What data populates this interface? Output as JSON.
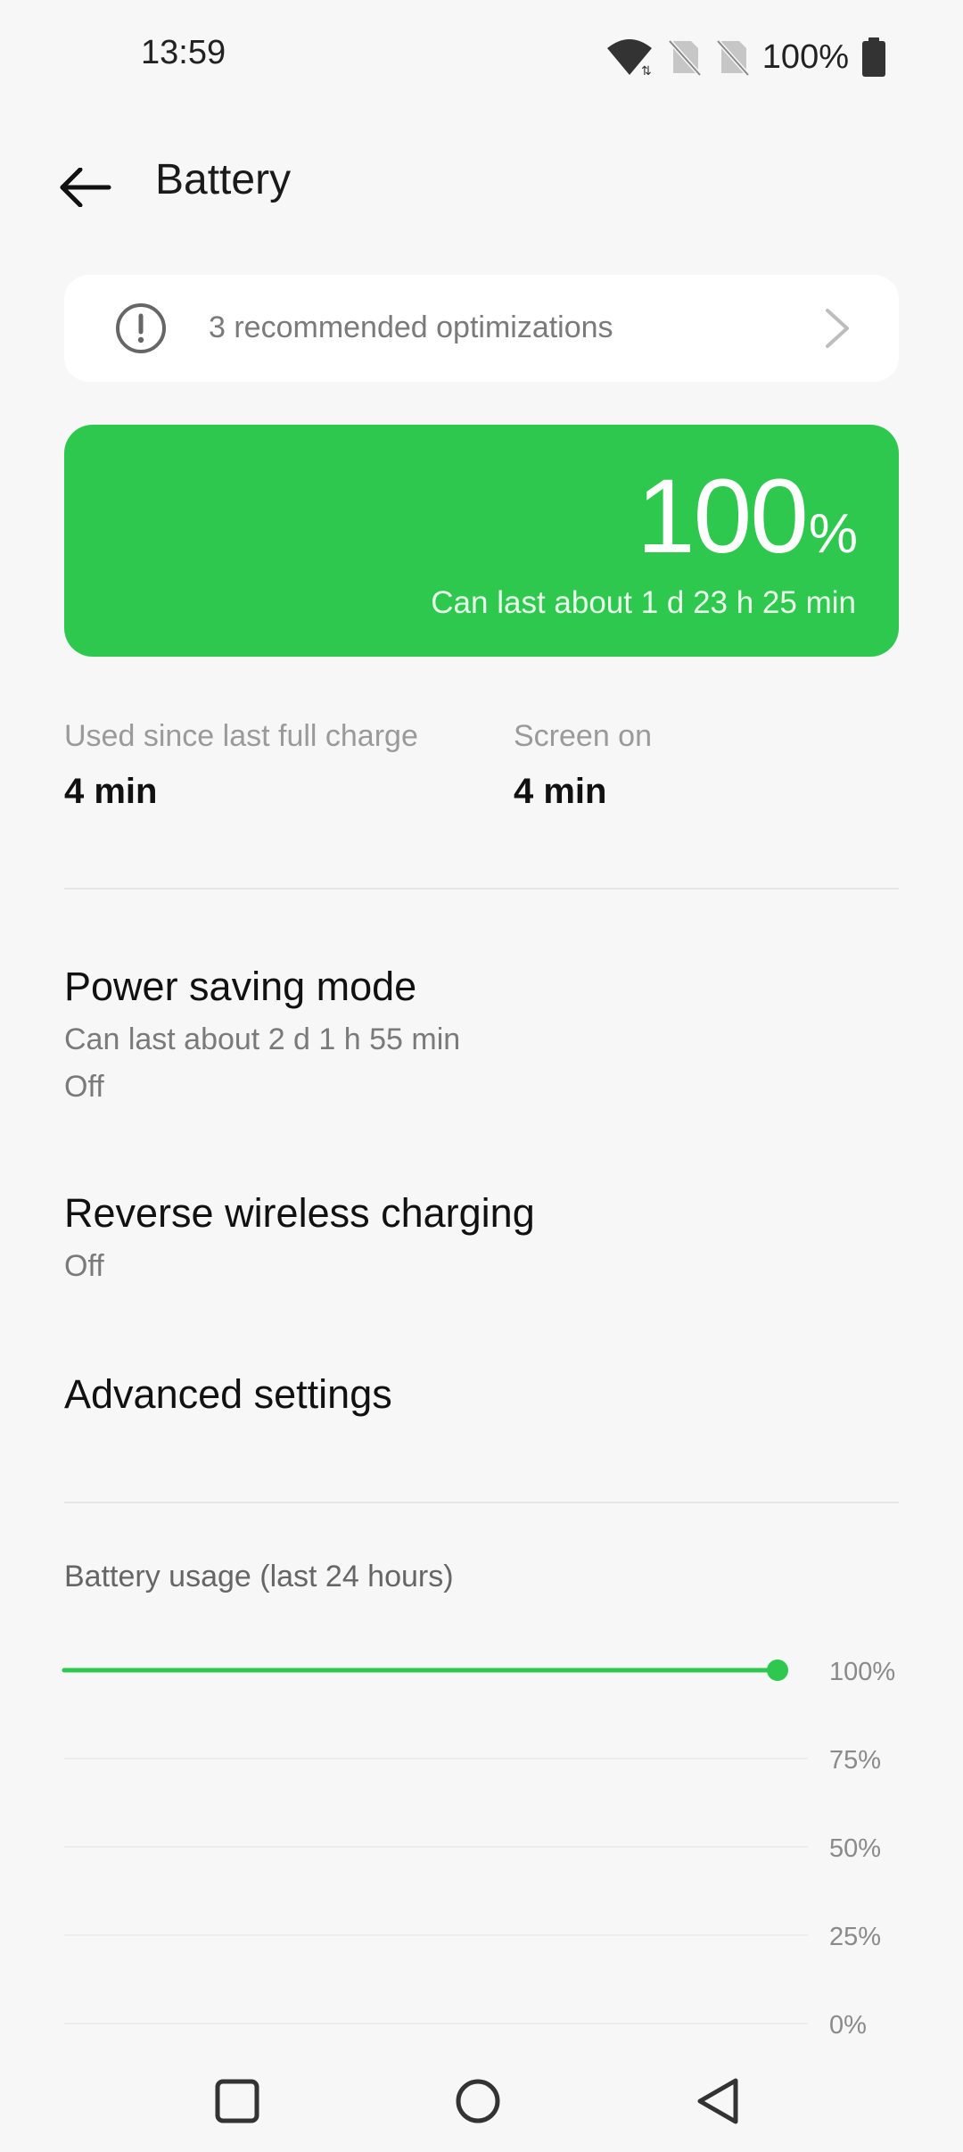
{
  "status_bar": {
    "time": "13:59",
    "battery_text": "100%",
    "icons": [
      "wifi-icon",
      "no-sim-icon",
      "no-sim-icon",
      "battery-full-icon"
    ]
  },
  "app_bar": {
    "title": "Battery",
    "back_icon": "back-arrow-icon"
  },
  "optimizations": {
    "icon": "alert-circle-icon",
    "text": "3 recommended optimizations",
    "chevron_icon": "chevron-right-icon"
  },
  "hero": {
    "percent": "100",
    "unit": "%",
    "estimate": "Can last about 1 d 23 h 25 min",
    "color": "#2fc84f"
  },
  "stats": {
    "used_label": "Used since last full charge",
    "used_value": "4 min",
    "screen_label": "Screen on",
    "screen_value": "4 min"
  },
  "settings": [
    {
      "title": "Power saving mode",
      "sub1": "Can last about 2 d 1 h 55 min",
      "sub2": "Off"
    },
    {
      "title": "Reverse wireless charging",
      "sub1": "Off"
    },
    {
      "title": "Advanced settings"
    }
  ],
  "chart": {
    "title": "Battery usage (last 24 hours)"
  },
  "chart_data": {
    "type": "line",
    "title": "Battery usage (last 24 hours)",
    "y_ticks": [
      "100%",
      "75%",
      "50%",
      "25%",
      "0%"
    ],
    "ylim": [
      0,
      100
    ],
    "xlim": [
      0,
      1
    ],
    "series": [
      {
        "points": [
          [
            0,
            100
          ],
          [
            1,
            100
          ]
        ],
        "color": "#2fc84f"
      }
    ],
    "grid": true
  },
  "nav_bar": {
    "icons": [
      "recents-square-icon",
      "home-circle-icon",
      "back-triangle-icon"
    ]
  }
}
